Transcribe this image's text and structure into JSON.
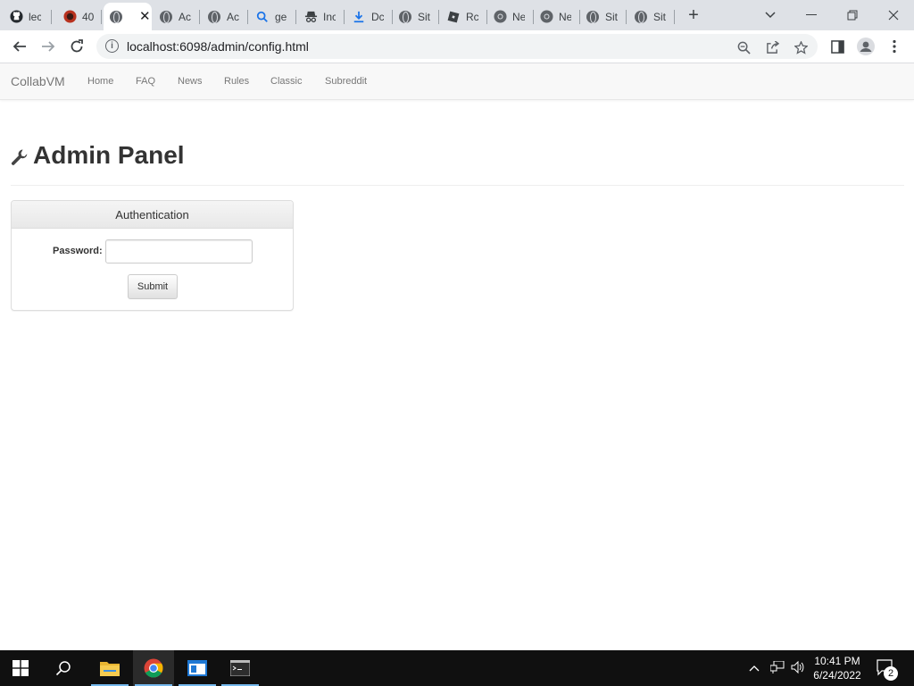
{
  "browser": {
    "tabs": [
      {
        "label": "lec",
        "icon": "github-icon"
      },
      {
        "label": "40",
        "icon": "alert-favicon"
      },
      {
        "label": "",
        "icon": "globe-icon",
        "active": true
      },
      {
        "label": "Ac",
        "icon": "globe-icon"
      },
      {
        "label": "Ac",
        "icon": "globe-icon"
      },
      {
        "label": "ge",
        "icon": "search-favicon"
      },
      {
        "label": "Inc",
        "icon": "incognito-favicon"
      },
      {
        "label": "Dc",
        "icon": "download-icon"
      },
      {
        "label": "Sit",
        "icon": "globe-icon"
      },
      {
        "label": "Rc",
        "icon": "roblox-favicon"
      },
      {
        "label": "Ne",
        "icon": "chrome-icon"
      },
      {
        "label": "Ne",
        "icon": "chrome-icon"
      },
      {
        "label": "Sit",
        "icon": "globe-icon"
      },
      {
        "label": "Sit",
        "icon": "globe-icon"
      }
    ],
    "url": "localhost:6098/admin/config.html"
  },
  "site": {
    "brand": "CollabVM",
    "nav": [
      "Home",
      "FAQ",
      "News",
      "Rules",
      "Classic",
      "Subreddit"
    ]
  },
  "page": {
    "title": "Admin Panel",
    "panel": {
      "heading": "Authentication",
      "password_label": "Password:",
      "password_value": "",
      "submit_label": "Submit"
    }
  },
  "taskbar": {
    "time": "10:41 PM",
    "date": "6/24/2022",
    "notification_count": "2"
  },
  "colors": {
    "tabstrip": "#dee1e6",
    "navbar": "#f8f8f8",
    "taskbar": "#101010"
  }
}
